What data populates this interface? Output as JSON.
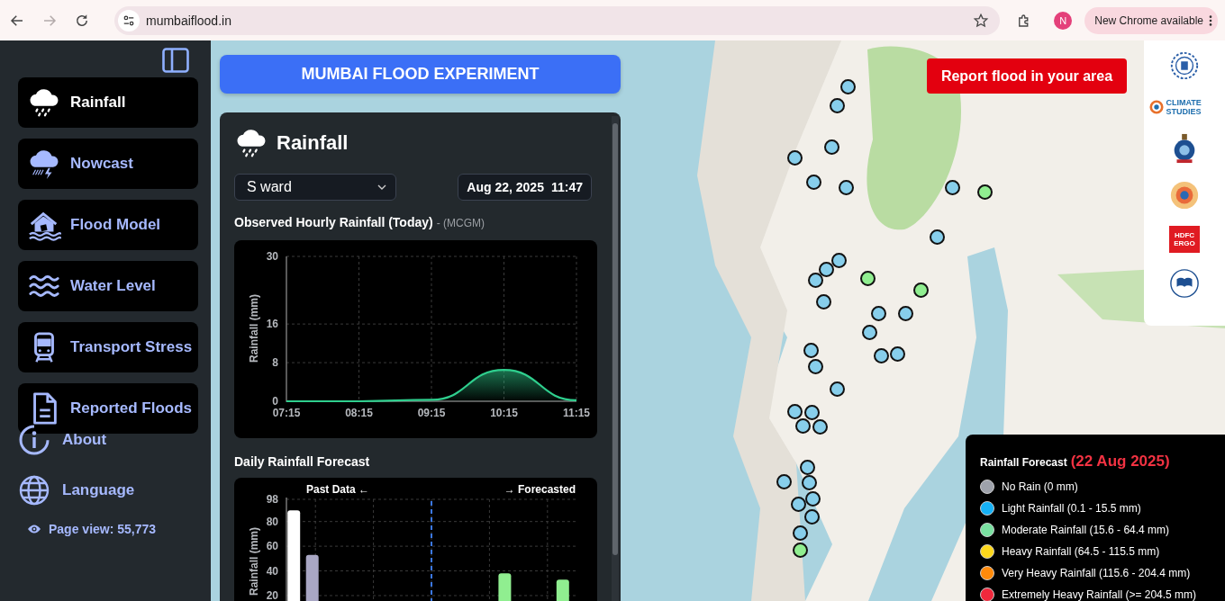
{
  "browser": {
    "url": "mumbaiflood.in",
    "forward_disabled": true,
    "profile_initial": "N",
    "update_label": "New Chrome available"
  },
  "sidebar": {
    "items": [
      {
        "label": "Rainfall",
        "kind": "rain",
        "selected": true
      },
      {
        "label": "Nowcast",
        "kind": "storm",
        "selected": false
      },
      {
        "label": "Flood Model",
        "kind": "flood",
        "selected": false
      },
      {
        "label": "Water Level",
        "kind": "waves",
        "selected": false
      },
      {
        "label": "Transport Stress",
        "kind": "train",
        "selected": false
      },
      {
        "label": "Reported Floods",
        "kind": "document",
        "selected": false
      }
    ],
    "links": [
      {
        "label": "About",
        "kind": "info"
      },
      {
        "label": "Language",
        "kind": "globe"
      }
    ],
    "page_view": "Page view: 55,773"
  },
  "header": {
    "title": "MUMBAI FLOOD EXPERIMENT"
  },
  "panel": {
    "title": "Rainfall",
    "ward_select": {
      "value": "S ward"
    },
    "date": "Aug 22, 2025",
    "time": "11:47",
    "observed": {
      "title": "Observed Hourly Rainfall (Today)",
      "source": "- (MCGM)",
      "chart_data": {
        "type": "area",
        "ylabel": "Rainfall (mm)",
        "categories": [
          "07:15",
          "08:15",
          "09:15",
          "10:15",
          "11:15"
        ],
        "ylim": [
          0,
          30
        ],
        "yticks": [
          0,
          8,
          16,
          30
        ],
        "grid": true,
        "series": [
          {
            "color": "#2fcf8e",
            "values": [
              0,
              0,
              0.3,
              6.5,
              0.2
            ]
          }
        ]
      }
    },
    "forecast": {
      "title": "Daily Rainfall Forecast",
      "chart_data": {
        "type": "bar",
        "ylabel": "Rainfall (mm)",
        "ylim": [
          0,
          98
        ],
        "yticks": [
          20,
          40,
          60,
          80,
          98
        ],
        "grid": true,
        "series": [
          {
            "color": "#ffffff",
            "values": [
              89,
              null,
              null,
              null,
              null
            ]
          },
          {
            "color": "#a9a7c4",
            "values": [
              53,
              null,
              null,
              null,
              null
            ]
          },
          {
            "color": "#90ee90",
            "values": [
              null,
              null,
              null,
              38,
              33
            ]
          }
        ],
        "annotations": [
          {
            "text": "Past Data ←"
          },
          {
            "text": "→ Forecasted"
          }
        ]
      }
    }
  },
  "map": {
    "report_button": "Report flood in your area",
    "markers": [
      {
        "color": "#87ceeb"
      },
      {
        "color": "#87ceeb"
      },
      {
        "color": "#87ceeb"
      },
      {
        "color": "#87ceeb"
      },
      {
        "color": "#87ceeb"
      },
      {
        "color": "#87ceeb"
      },
      {
        "color": "#87ceeb"
      },
      {
        "color": "#90ee90"
      },
      {
        "color": "#87ceeb"
      },
      {
        "color": "#87ceeb"
      },
      {
        "color": "#87ceeb"
      },
      {
        "color": "#87ceeb"
      },
      {
        "color": "#90ee90"
      },
      {
        "color": "#90ee90"
      },
      {
        "color": "#87ceeb"
      },
      {
        "color": "#87ceeb"
      },
      {
        "color": "#87ceeb"
      },
      {
        "color": "#87ceeb"
      },
      {
        "color": "#87ceeb"
      },
      {
        "color": "#87ceeb"
      },
      {
        "color": "#87ceeb"
      },
      {
        "color": "#87ceeb"
      },
      {
        "color": "#87ceeb"
      },
      {
        "color": "#87ceeb"
      },
      {
        "color": "#87ceeb"
      },
      {
        "color": "#87ceeb"
      },
      {
        "color": "#87ceeb"
      },
      {
        "color": "#87ceeb"
      },
      {
        "color": "#87ceeb"
      },
      {
        "color": "#87ceeb"
      },
      {
        "color": "#87ceeb"
      },
      {
        "color": "#87ceeb"
      },
      {
        "color": "#87ceeb"
      },
      {
        "color": "#87ceeb"
      },
      {
        "color": "#90ee90"
      }
    ],
    "logos": [
      {
        "kind": "gear"
      },
      {
        "kind": "swirl",
        "text": "CLIMATE STUDIES"
      },
      {
        "kind": "crest"
      },
      {
        "kind": "seal"
      },
      {
        "kind": "block",
        "text": "HDFC ERGO"
      },
      {
        "kind": "book"
      }
    ],
    "legend": {
      "title": "Rainfall Forecast",
      "date": "(22 Aug 2025)",
      "items": [
        {
          "label": "No Rain (0 mm)",
          "color": "#9ea2ab"
        },
        {
          "label": "Light Rainfall (0.1 - 15.5 mm)",
          "color": "#16b1f5"
        },
        {
          "label": "Moderate Rainfall (15.6 - 64.4 mm)",
          "color": "#79e0a0"
        },
        {
          "label": "Heavy Rainfall (64.5 - 115.5 mm)",
          "color": "#fcd71c"
        },
        {
          "label": "Very Heavy Rainfall (115.6 - 204.4 mm)",
          "color": "#ff8a0a"
        },
        {
          "label": "Extremely Heavy Rainfall (>= 204.5 mm)",
          "color": "#f0283c"
        }
      ]
    }
  }
}
